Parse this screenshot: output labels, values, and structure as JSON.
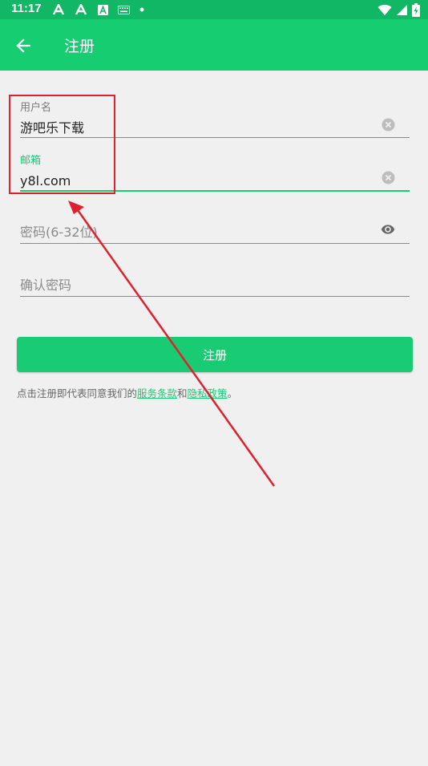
{
  "status_bar": {
    "time": "11:17"
  },
  "app_bar": {
    "title": "注册"
  },
  "form": {
    "username": {
      "label": "用户名",
      "value": "游吧乐下载"
    },
    "email": {
      "label": "邮箱",
      "value": "y8l.com"
    },
    "password": {
      "placeholder": "密码(6-32位)"
    },
    "confirm_password": {
      "placeholder": "确认密码"
    }
  },
  "register_button": {
    "label": "注册"
  },
  "terms": {
    "prefix": "点击注册即代表同意我们的",
    "service_link": "服务条款",
    "and": "和",
    "privacy_link": "隐私政策",
    "suffix": "。"
  },
  "colors": {
    "primary": "#16cd72",
    "status_bar": "#12b765",
    "annotation": "#e0202e"
  }
}
